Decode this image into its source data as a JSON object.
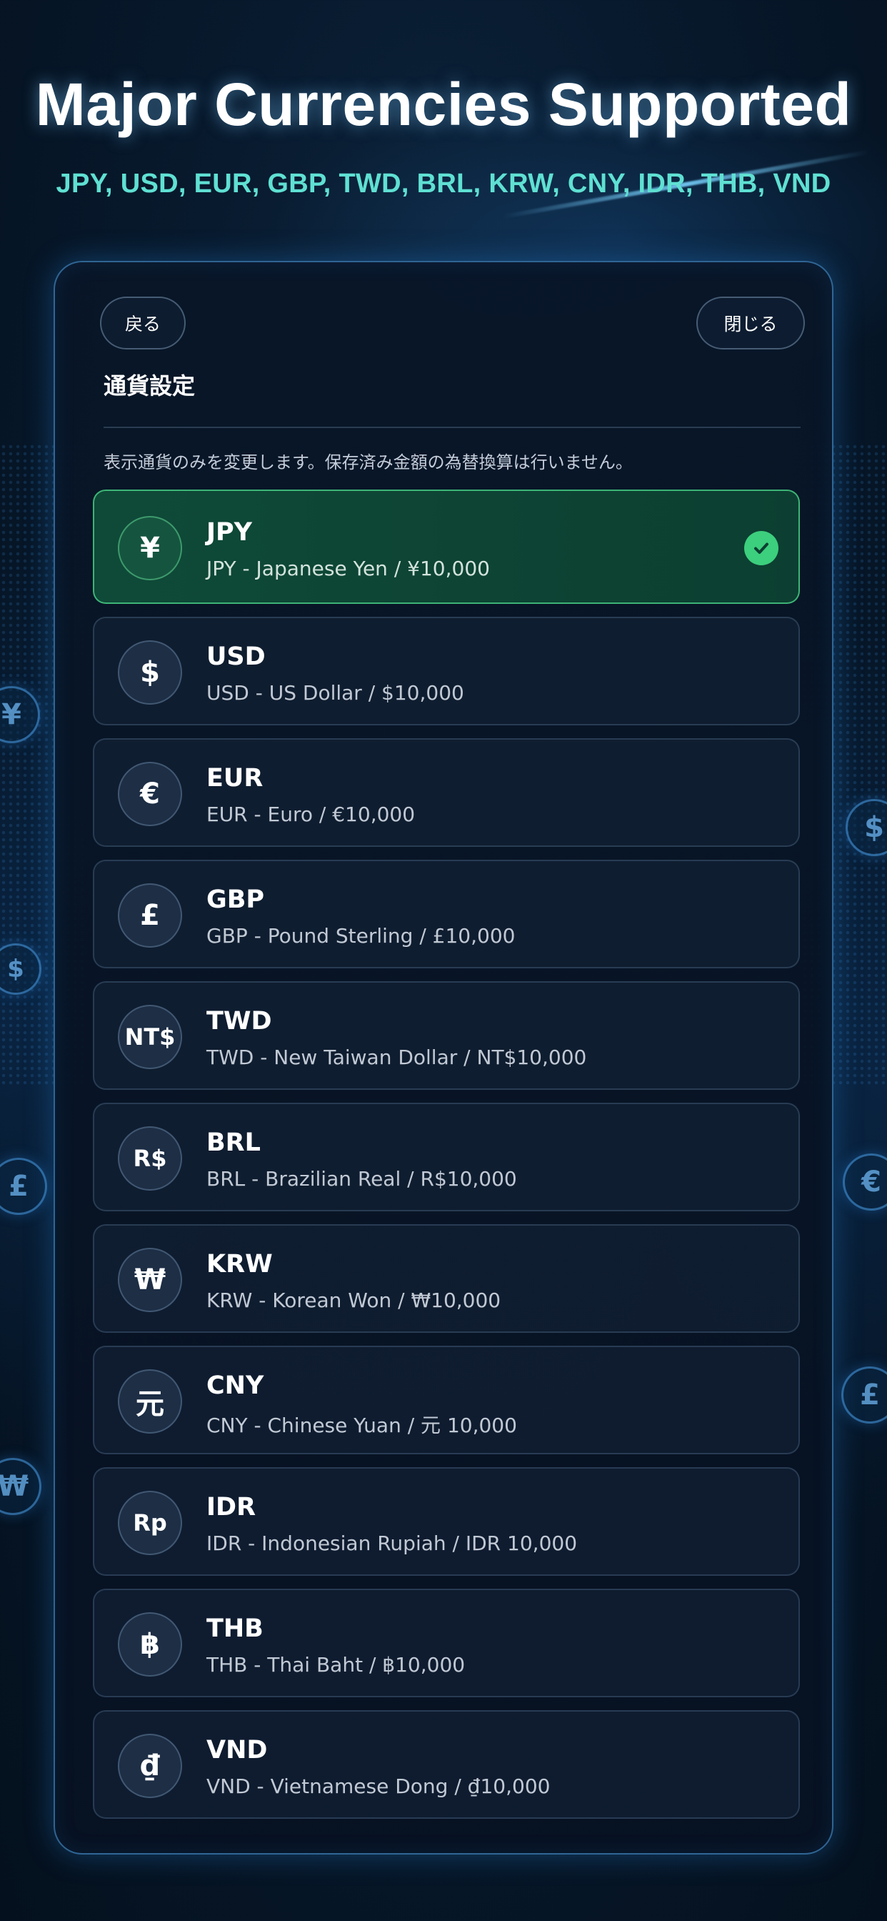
{
  "headline": "Major Currencies Supported",
  "subline": "JPY, USD, EUR, GBP, TWD, BRL, KRW, CNY, IDR, THB, VND",
  "panel": {
    "back_label": "戻る",
    "close_label": "閉じる",
    "title": "通貨設定",
    "note": "表示通貨のみを変更します。保存済み金額の為替換算は行いません。"
  },
  "currencies": [
    {
      "symbol": "¥",
      "code": "JPY",
      "description": "JPY - Japanese Yen / ¥10,000",
      "selected": true
    },
    {
      "symbol": "$",
      "code": "USD",
      "description": "USD - US Dollar / $10,000",
      "selected": false
    },
    {
      "symbol": "€",
      "code": "EUR",
      "description": "EUR - Euro / €10,000",
      "selected": false
    },
    {
      "symbol": "£",
      "code": "GBP",
      "description": "GBP - Pound Sterling / £10,000",
      "selected": false
    },
    {
      "symbol": "NT$",
      "code": "TWD",
      "description": "TWD - New Taiwan Dollar / NT$10,000",
      "selected": false
    },
    {
      "symbol": "R$",
      "code": "BRL",
      "description": "BRL - Brazilian Real / R$10,000",
      "selected": false
    },
    {
      "symbol": "₩",
      "code": "KRW",
      "description": "KRW - Korean Won / ₩10,000",
      "selected": false
    },
    {
      "symbol": "元",
      "code": "CNY",
      "description": "CNY - Chinese Yuan / 元 10,000",
      "selected": false
    },
    {
      "symbol": "Rp",
      "code": "IDR",
      "description": "IDR - Indonesian Rupiah / IDR 10,000",
      "selected": false
    },
    {
      "symbol": "฿",
      "code": "THB",
      "description": "THB - Thai Baht / ฿10,000",
      "selected": false
    },
    {
      "symbol": "₫",
      "code": "VND",
      "description": "VND - Vietnamese Dong / ₫10,000",
      "selected": false
    }
  ],
  "decor_symbols": [
    "¥",
    "$",
    "£",
    "₩",
    "$",
    "€",
    "£"
  ],
  "colors": {
    "accent_teal": "#5fe0d2",
    "selected_green": "#3ccf7d",
    "background": "#081a2e"
  }
}
